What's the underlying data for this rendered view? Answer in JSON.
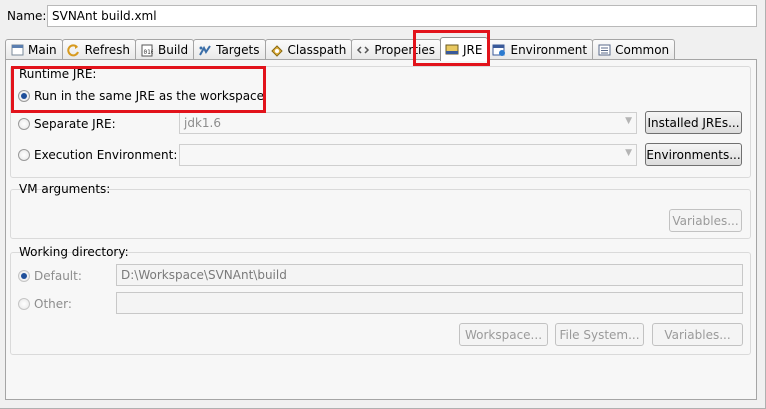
{
  "name_row": {
    "label": "Name:",
    "value": "SVNAnt build.xml"
  },
  "tabs": [
    {
      "label": "Main",
      "icon": "main-icon"
    },
    {
      "label": "Refresh",
      "icon": "refresh-icon"
    },
    {
      "label": "Build",
      "icon": "build-icon"
    },
    {
      "label": "Targets",
      "icon": "targets-icon"
    },
    {
      "label": "Classpath",
      "icon": "classpath-icon"
    },
    {
      "label": "Properties",
      "icon": "properties-icon"
    },
    {
      "label": "JRE",
      "icon": "jre-icon",
      "active": true
    },
    {
      "label": "Environment",
      "icon": "environment-icon"
    },
    {
      "label": "Common",
      "icon": "common-icon"
    }
  ],
  "runtime_jre": {
    "title": "Runtime JRE:",
    "same_jre_label": "Run in the same JRE as the workspace",
    "separate_jre_label": "Separate JRE:",
    "separate_jre_value": "jdk1.6",
    "installed_jres_button": "Installed JREs...",
    "exec_env_label": "Execution Environment:",
    "exec_env_value": "",
    "environments_button": "Environments..."
  },
  "vm_arguments": {
    "title": "VM arguments:",
    "value": "",
    "variables_button": "Variables..."
  },
  "working_directory": {
    "title": "Working directory:",
    "default_label": "Default:",
    "default_value": "D:\\Workspace\\SVNAnt\\build",
    "other_label": "Other:",
    "other_value": "",
    "workspace_button": "Workspace...",
    "file_system_button": "File System...",
    "variables_button": "Variables..."
  },
  "colors": {
    "highlight": "#e2131b",
    "radio_selected": "#1f4f9a"
  }
}
